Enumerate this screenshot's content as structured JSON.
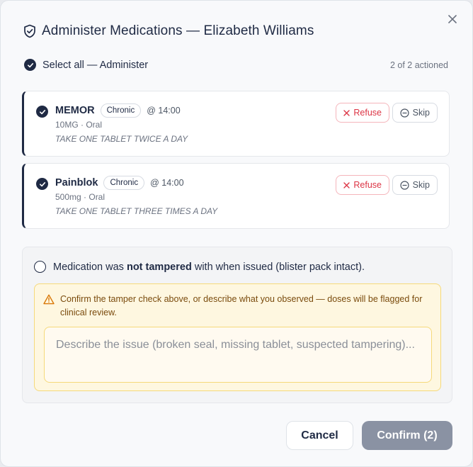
{
  "dialog": {
    "title": "Administer Medications — Elizabeth Williams",
    "close_icon": "close-icon",
    "title_icon": "shield-check-icon"
  },
  "select_all": {
    "label": "Select all — Administer",
    "checked": true,
    "actioned_text": "2 of 2 actioned"
  },
  "medications": [
    {
      "name": "MEMOR",
      "badge": "Chronic",
      "time": "@ 14:00",
      "dose": "10MG · Oral",
      "instructions": "TAKE ONE TABLET TWICE A DAY",
      "refuse_label": "Refuse",
      "skip_label": "Skip",
      "selected": true
    },
    {
      "name": "Painblok",
      "badge": "Chronic",
      "time": "@ 14:00",
      "dose": "500mg · Oral",
      "instructions": "TAKE ONE TABLET THREE TIMES A DAY",
      "refuse_label": "Refuse",
      "skip_label": "Skip",
      "selected": true
    }
  ],
  "tamper_check": {
    "text_before": "Medication was ",
    "text_bold": "not tampered",
    "text_after": " with when issued (blister pack intact).",
    "checked": false
  },
  "warning": {
    "text": "Confirm the tamper check above, or describe what you observed — doses will be flagged for clinical review.",
    "issue_placeholder": "Describe the issue (broken seal, missing tablet, suspected tampering)...",
    "issue_value": ""
  },
  "footer": {
    "cancel_label": "Cancel",
    "confirm_label": "Confirm (2)"
  },
  "colors": {
    "primary": "#1f2a44",
    "refuse_red": "#dc3545",
    "warning_bg": "#fef7e0",
    "warning_border": "#f5d97a",
    "confirm_disabled": "#8a92a3"
  }
}
